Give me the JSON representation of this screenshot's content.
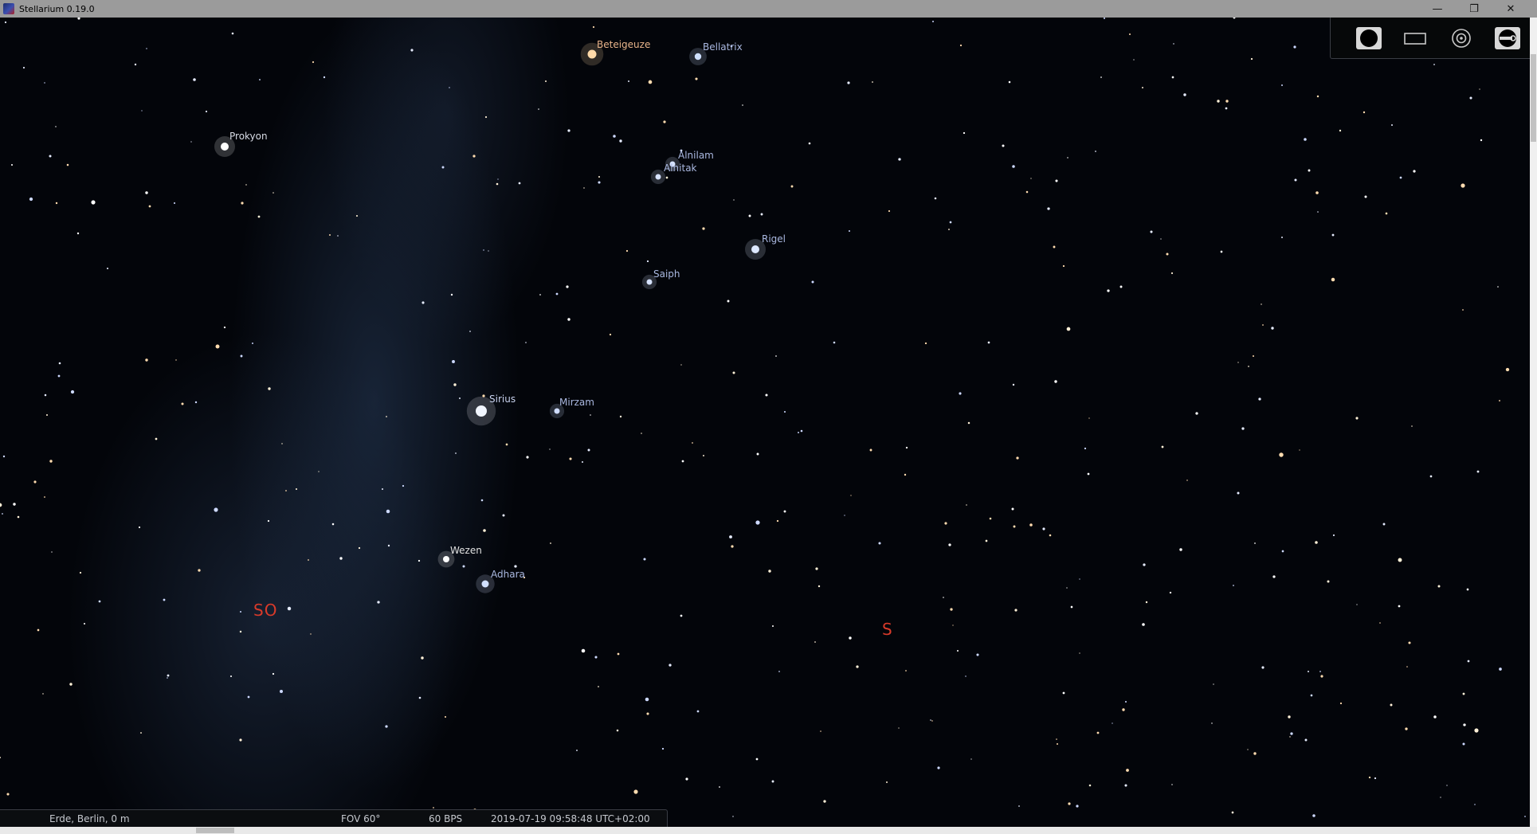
{
  "window": {
    "title": "Stellarium 0.19.0",
    "controls": {
      "minimize": "—",
      "maximize": "❐",
      "close": "✕"
    }
  },
  "sky": {
    "labeled_stars": [
      {
        "name": "Beteigeuze",
        "color": "#e9b48a"
      },
      {
        "name": "Bellatrix",
        "color": "#aab8e0"
      },
      {
        "name": "Prokyon",
        "color": "#d8dce6"
      },
      {
        "name": "Alnilam",
        "color": "#aab8e0"
      },
      {
        "name": "Alnitak",
        "color": "#aab8e0"
      },
      {
        "name": "Rigel",
        "color": "#aab8e0"
      },
      {
        "name": "Saiph",
        "color": "#aab8e0"
      },
      {
        "name": "Sirius",
        "color": "#c8d2ee"
      },
      {
        "name": "Mirzam",
        "color": "#aab8e0"
      },
      {
        "name": "Wezen",
        "color": "#e2e2e2"
      },
      {
        "name": "Adhara",
        "color": "#aab8e0"
      }
    ],
    "cardinal_points": [
      {
        "label": "SO"
      },
      {
        "label": "S"
      }
    ],
    "cardinal_color": "#d83a2a"
  },
  "toolbar": {
    "buttons": [
      {
        "name": "night-view-icon"
      },
      {
        "name": "fullscreen-icon"
      },
      {
        "name": "object-tracking-icon"
      },
      {
        "name": "quit-icon"
      }
    ]
  },
  "status": {
    "location": "Erde, Berlin, 0 m",
    "fov": "FOV 60°",
    "fps": "60 BPS",
    "datetime": "2019-07-19 09:58:48 UTC+02:00"
  }
}
